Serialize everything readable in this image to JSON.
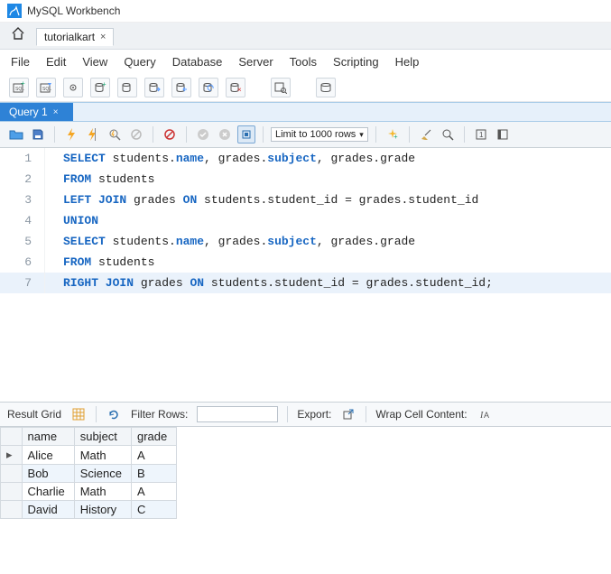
{
  "window": {
    "title": "MySQL Workbench"
  },
  "connectionTab": {
    "label": "tutorialkart"
  },
  "menu": [
    "File",
    "Edit",
    "View",
    "Query",
    "Database",
    "Server",
    "Tools",
    "Scripting",
    "Help"
  ],
  "queryTab": {
    "label": "Query 1"
  },
  "limit": {
    "label": "Limit to 1000 rows"
  },
  "code": {
    "l1a": "SELECT",
    "l1b": " students.",
    "l1c": "name",
    "l1d": ", grades.",
    "l1e": "subject",
    "l1f": ", grades.grade",
    "l2a": "FROM",
    "l2b": " students",
    "l3a": "LEFT JOIN",
    "l3b": " grades ",
    "l3c": "ON",
    "l3d": " students.student_id = grades.student_id",
    "l4a": "UNION",
    "l5a": "SELECT",
    "l5b": " students.",
    "l5c": "name",
    "l5d": ", grades.",
    "l5e": "subject",
    "l5f": ", grades.grade",
    "l6a": "FROM",
    "l6b": " students",
    "l7a": "RIGHT JOIN",
    "l7b": " grades ",
    "l7c": "ON",
    "l7d": " students.student_id = grades.student_id;"
  },
  "lineNumbers": [
    "1",
    "2",
    "3",
    "4",
    "5",
    "6",
    "7"
  ],
  "resultsBar": {
    "resultGrid": "Result Grid",
    "filterLabel": "Filter Rows:",
    "export": "Export:",
    "wrap": "Wrap Cell Content:"
  },
  "grid": {
    "headers": [
      "name",
      "subject",
      "grade"
    ],
    "rows": [
      {
        "name": "Alice",
        "subject": "Math",
        "grade": "A"
      },
      {
        "name": "Bob",
        "subject": "Science",
        "grade": "B"
      },
      {
        "name": "Charlie",
        "subject": "Math",
        "grade": "A"
      },
      {
        "name": "David",
        "subject": "History",
        "grade": "C"
      }
    ]
  }
}
